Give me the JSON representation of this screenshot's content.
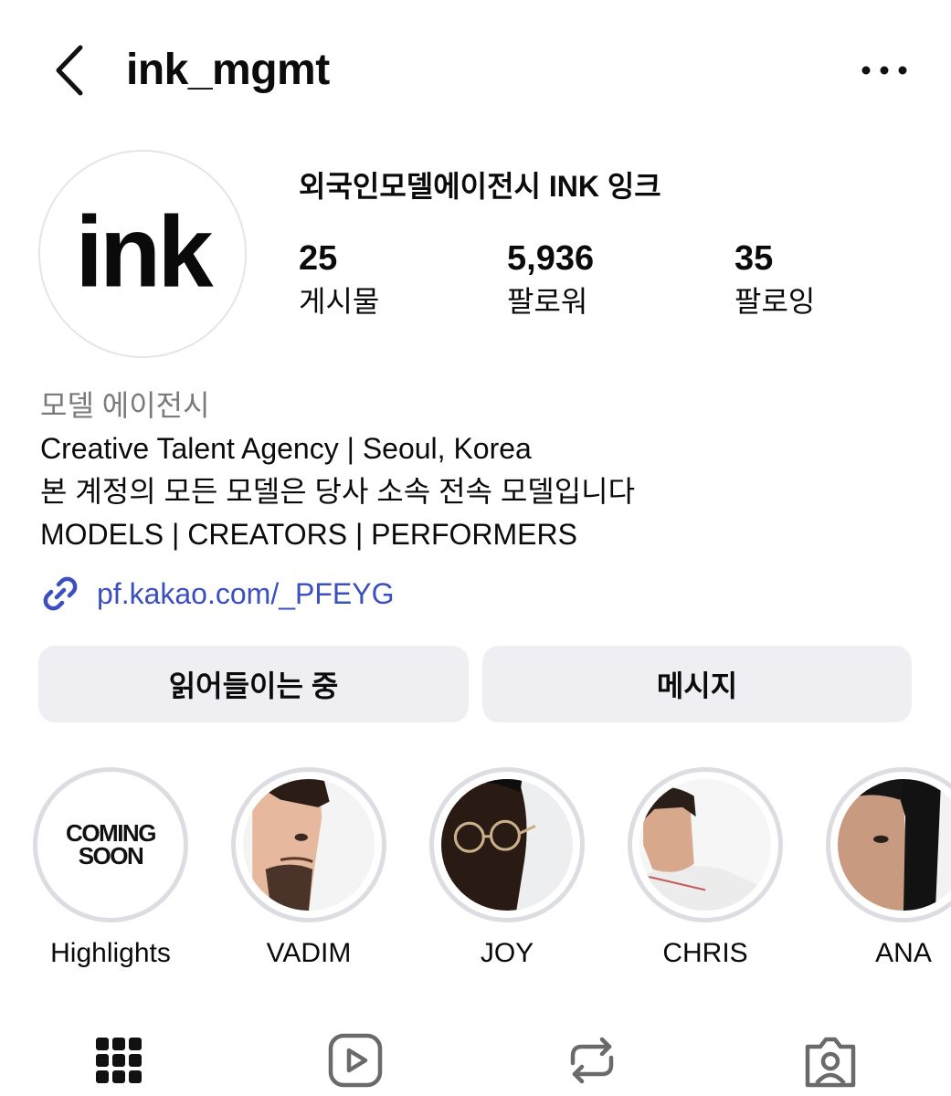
{
  "header": {
    "username": "ink_mgmt"
  },
  "profile": {
    "display_name": "외국인모델에이전시 INK 잉크",
    "avatar_logo_text": "ink",
    "stats": [
      {
        "value": "25",
        "label": "게시물"
      },
      {
        "value": "5,936",
        "label": "팔로워"
      },
      {
        "value": "35",
        "label": "팔로잉"
      }
    ]
  },
  "bio": {
    "category": "모델 에이전시",
    "lines": [
      "Creative Talent Agency | Seoul, Korea",
      "본 계정의 모든 모델은 당사 소속 전속 모델입니다",
      "MODELS | CREATORS | PERFORMERS"
    ],
    "link": "pf.kakao.com/_PFEYG"
  },
  "actions": {
    "follow_label": "읽어들이는 중",
    "message_label": "메시지"
  },
  "highlights": [
    {
      "label": "Highlights",
      "cover_text": [
        "COMING",
        "SOON"
      ]
    },
    {
      "label": "VADIM"
    },
    {
      "label": "JOY"
    },
    {
      "label": "CHRIS"
    },
    {
      "label": "ANA"
    }
  ],
  "tabs": [
    {
      "icon": "grid-icon"
    },
    {
      "icon": "reels-icon"
    },
    {
      "icon": "reposts-icon"
    },
    {
      "icon": "tagged-icon"
    }
  ]
}
